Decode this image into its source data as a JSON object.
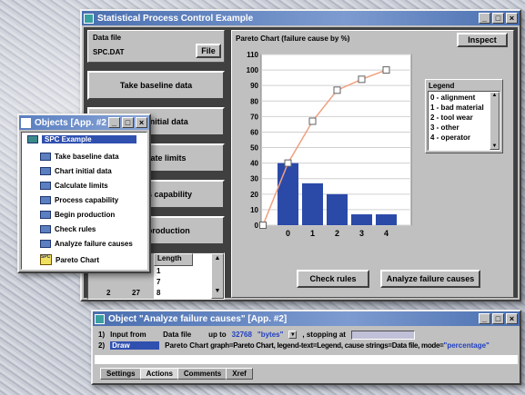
{
  "main_window": {
    "title": "Statistical Process Control Example",
    "data_file_label": "Data file",
    "data_file_value": "SPC.DAT",
    "file_button": "File",
    "left_buttons": [
      "Take baseline data",
      "Chart initial data",
      "Calculate limits",
      "Process capability",
      "Begin production"
    ],
    "table": {
      "length_header": "Length",
      "rows": [
        {
          "a": "",
          "b": "",
          "length": "1"
        },
        {
          "a": "",
          "b": "",
          "length": "7"
        },
        {
          "a": "2",
          "b": "27",
          "length": "8"
        }
      ]
    },
    "chart_title": "Pareto Chart (failure cause by %)",
    "inspect_button": "Inspect",
    "legend": {
      "title": "Legend",
      "items": [
        "0 - alignment",
        "1 - bad material",
        "2 - tool wear",
        "3 - other",
        "4 - operator"
      ]
    },
    "check_rules_button": "Check rules",
    "analyze_button": "Analyze failure causes"
  },
  "chart_data": {
    "type": "bar",
    "title": "Pareto Chart (failure cause by %)",
    "categories": [
      "0",
      "1",
      "2",
      "3",
      "4"
    ],
    "series": [
      {
        "kind": "bar",
        "values": [
          40,
          27,
          20,
          7,
          7
        ]
      },
      {
        "kind": "line",
        "values": [
          40,
          67,
          87,
          94,
          100
        ]
      }
    ],
    "ylim": [
      0,
      110
    ],
    "yticks": [
      "0",
      "10",
      "20",
      "30",
      "40",
      "50",
      "60",
      "70",
      "80",
      "90",
      "100",
      "110"
    ],
    "grid": true,
    "colors": {
      "bar": "#2b4aa8",
      "line": "#f0a080",
      "marker": "#ffffff"
    }
  },
  "objects_window": {
    "title": "Objects [App. #2]",
    "root": "SPC Example",
    "items": [
      {
        "label": "Take baseline data",
        "icon": "action-icon"
      },
      {
        "label": "Chart initial data",
        "icon": "action-icon"
      },
      {
        "label": "Calculate limits",
        "icon": "action-icon"
      },
      {
        "label": "Process capability",
        "icon": "action-icon"
      },
      {
        "label": "Begin production",
        "icon": "action-icon"
      },
      {
        "label": "Check rules",
        "icon": "action-icon"
      },
      {
        "label": "Analyze failure causes",
        "icon": "action-icon"
      },
      {
        "label": "Pareto Chart",
        "icon": "spc-chart-icon"
      }
    ]
  },
  "object_window": {
    "title": "Object \"Analyze failure causes\" [App. #2]",
    "row1": {
      "num": "1)",
      "verb": "Input from",
      "source": "Data file",
      "up_to": "up to",
      "count": "32768",
      "unit": "\"bytes\"",
      "stopping": ", stopping at"
    },
    "row2": {
      "num": "2)",
      "verb": "Draw",
      "target": "Pareto Chart",
      "params": "graph=Pareto Chart, legend-text=Legend, cause strings=Data file, mode=",
      "mode": "\"percentage\""
    },
    "tabs": [
      "Settings",
      "Actions",
      "Comments",
      "Xref"
    ],
    "active_tab": "Actions"
  }
}
